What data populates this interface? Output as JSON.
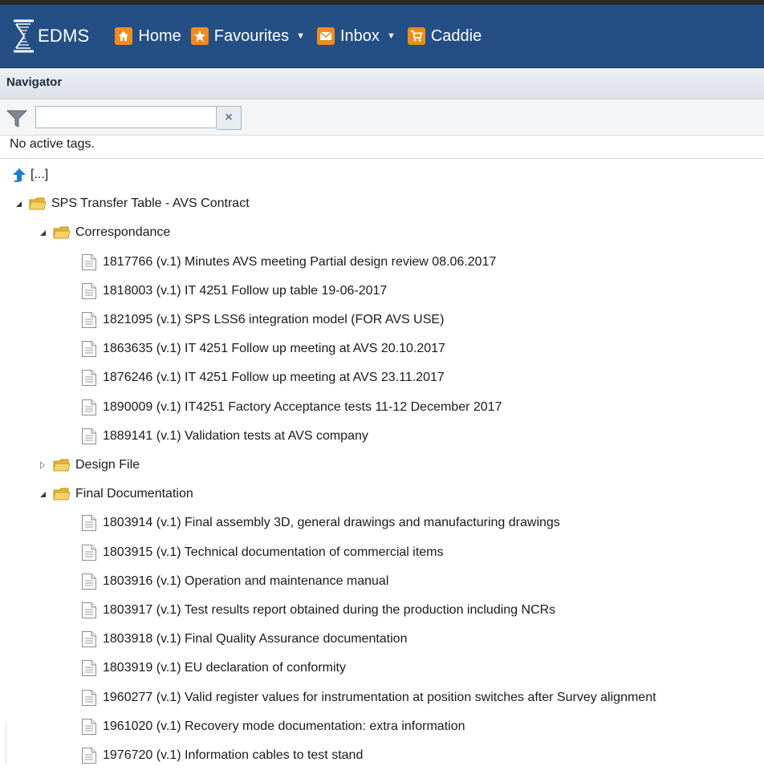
{
  "app": {
    "name": "EDMS",
    "nav": [
      {
        "label": "Home",
        "icon": "home-icon",
        "dropdown": false
      },
      {
        "label": "Favourites",
        "icon": "star-icon",
        "dropdown": true
      },
      {
        "label": "Inbox",
        "icon": "mail-icon",
        "dropdown": true
      },
      {
        "label": "Caddie",
        "icon": "cart-icon",
        "dropdown": false
      }
    ],
    "accent_color": "#f08c1e",
    "topbar_color": "#234f85"
  },
  "navigator": {
    "title": "Navigator",
    "filter": {
      "value": "",
      "placeholder": "",
      "clear_label": "×"
    },
    "status": "No active tags.",
    "up_label": "[...]"
  },
  "tree": {
    "root": {
      "label": "SPS Transfer Table - AVS Contract",
      "expanded": true
    },
    "folders": [
      {
        "label": "Correspondance",
        "expanded": true,
        "documents": [
          "1817766 (v.1) Minutes AVS meeting Partial design review 08.06.2017",
          "1818003 (v.1) IT 4251 Follow up table 19-06-2017",
          "1821095 (v.1) SPS LSS6 integration model (FOR AVS USE)",
          "1863635 (v.1) IT 4251 Follow up meeting at AVS 20.10.2017",
          "1876246 (v.1) IT 4251 Follow up meeting at AVS 23.11.2017",
          "1890009 (v.1) IT4251 Factory Acceptance tests 11-12 December 2017",
          "1889141 (v.1) Validation tests at AVS company"
        ]
      },
      {
        "label": "Design File",
        "expanded": false,
        "documents": []
      },
      {
        "label": "Final Documentation",
        "expanded": true,
        "documents": [
          "1803914 (v.1) Final assembly 3D, general drawings and manufacturing drawings",
          "1803915 (v.1) Technical documentation of commercial items",
          "1803916 (v.1) Operation and maintenance manual",
          "1803917 (v.1) Test results report obtained during the production including NCRs",
          "1803918 (v.1) Final Quality Assurance documentation",
          "1803919 (v.1) EU declaration of conformity",
          "1960277 (v.1) Valid register values for instrumentation at position switches after Survey alignment",
          "1961020 (v.1) Recovery mode documentation: extra information",
          "1976720 (v.1) Information cables to test stand"
        ]
      }
    ]
  }
}
